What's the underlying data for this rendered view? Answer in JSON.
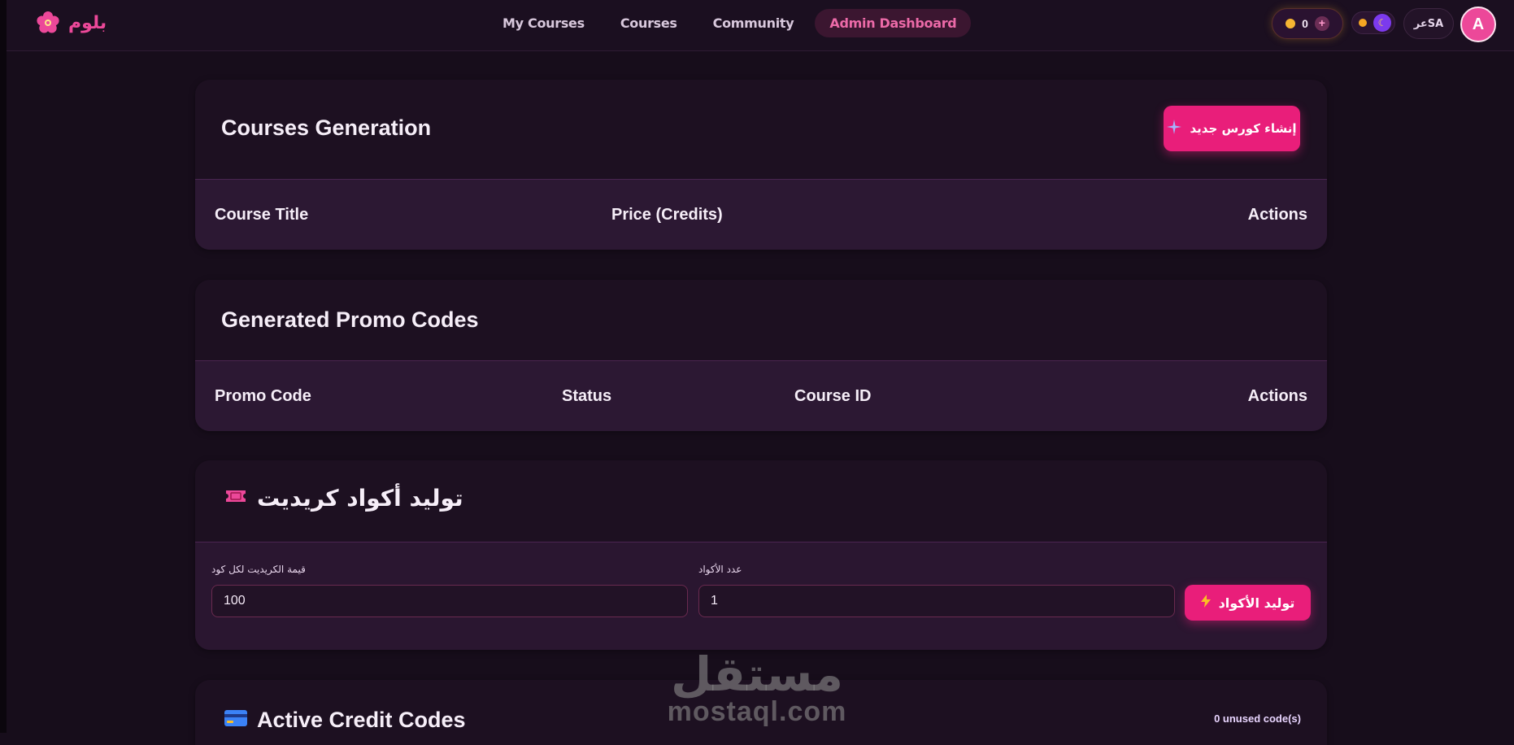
{
  "nav": {
    "logo_text": "بلوم",
    "links": [
      "My Courses",
      "Courses",
      "Community",
      "Admin Dashboard"
    ],
    "credits": "0",
    "add_credits": "+",
    "language": "عرSA",
    "avatar_letter": "A"
  },
  "courses_card": {
    "title": "Courses Generation",
    "create_button": "إنشاء كورس جديد",
    "columns": [
      "Course Title",
      "Price (Credits)",
      "Actions"
    ]
  },
  "promo_card": {
    "title": "Generated Promo Codes",
    "columns": [
      "Promo Code",
      "Status",
      "Course ID",
      "Actions"
    ]
  },
  "credit_gen_card": {
    "title": "توليد أكواد كريديت",
    "title_icon": "ticket-icon",
    "credit_value_label": "قيمة الكريديت لكل كود",
    "credit_value": "100",
    "count_label": "عدد الأكواد",
    "count_value": "1",
    "generate_button": "توليد الأكواد",
    "generate_icon": "lightning-icon"
  },
  "active_codes_card": {
    "title": "Active Credit Codes",
    "title_icon": "credit-card-icon",
    "unused_count": "0 unused code(s)"
  },
  "watermark": {
    "arabic": "مستقل",
    "latin": "mostaql.com"
  },
  "colors": {
    "accent": "#ec4899",
    "primary_button": "#e91e7a",
    "background": "#170d1b",
    "card": "#1d1021",
    "table_header": "#2c1833"
  }
}
